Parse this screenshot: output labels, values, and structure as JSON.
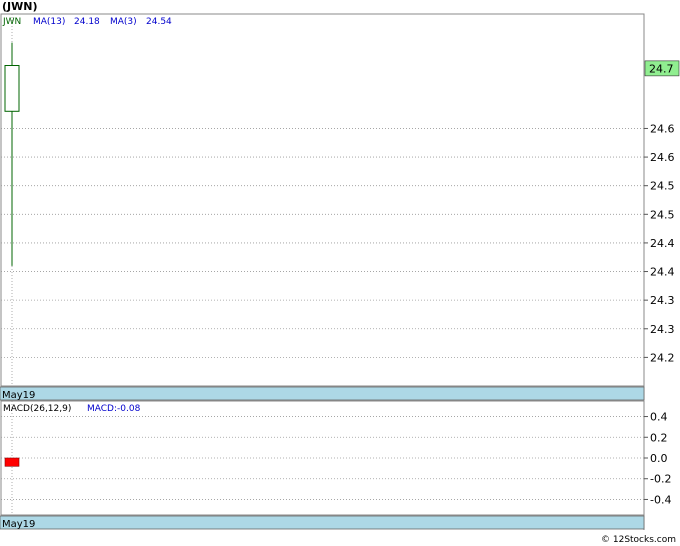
{
  "title": "(JWN)",
  "footer": "© 12Stocks.com",
  "colors": {
    "up_candle": "#006400",
    "ma_text": "#0000cc",
    "last_price_box": "#90ee90",
    "date_bar": "#add8e6",
    "macd_bar": "#ff0000",
    "grid": "#999999"
  },
  "chart_data": [
    {
      "type": "candlestick",
      "legend": {
        "symbol": "JWN",
        "ma13_label": "MA(13)",
        "ma13_value": "24.18",
        "ma3_label": "MA(3)",
        "ma3_value": "24.54"
      },
      "candles": [
        {
          "date": "May19",
          "open": 24.63,
          "close": 24.71,
          "high": 24.75,
          "low": 24.36
        }
      ],
      "last_price": "24.7",
      "last_value": 24.705,
      "ylim": [
        24.15,
        24.8
      ],
      "yticks": [
        {
          "value": 24.2,
          "label": "24.2"
        },
        {
          "value": 24.25,
          "label": "24.3"
        },
        {
          "value": 24.3,
          "label": "24.3"
        },
        {
          "value": 24.35,
          "label": "24.4"
        },
        {
          "value": 24.4,
          "label": "24.4"
        },
        {
          "value": 24.45,
          "label": "24.5"
        },
        {
          "value": 24.5,
          "label": "24.5"
        },
        {
          "value": 24.55,
          "label": "24.6"
        },
        {
          "value": 24.6,
          "label": "24.6"
        }
      ],
      "xlabel": "May19",
      "grid": true
    },
    {
      "type": "bar",
      "legend": {
        "name": "MACD(26,12,9)",
        "value_label": "MACD:-0.08"
      },
      "categories": [
        "May19"
      ],
      "values": [
        -0.08
      ],
      "ylim": [
        -0.55,
        0.55
      ],
      "yticks": [
        {
          "value": 0.4,
          "label": "0.4"
        },
        {
          "value": 0.2,
          "label": "0.2"
        },
        {
          "value": 0.0,
          "label": "0.0"
        },
        {
          "value": -0.2,
          "label": "-0.2"
        },
        {
          "value": -0.4,
          "label": "-0.4"
        }
      ],
      "xlabel": "May19",
      "grid": true
    }
  ]
}
